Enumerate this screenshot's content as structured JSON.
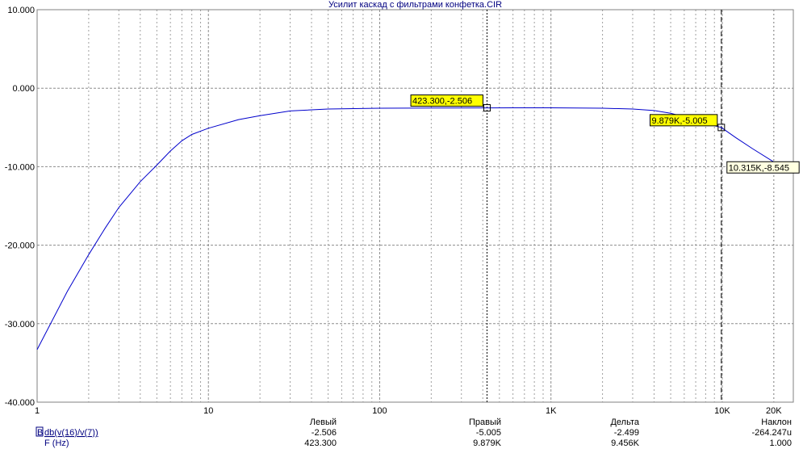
{
  "chart_data": {
    "type": "line",
    "title": "Усилит каскад с фильтрами конфетка.CIR",
    "x_scale": "log",
    "xlim": [
      1,
      26000
    ],
    "ylim": [
      -40,
      10
    ],
    "y_ticks": [
      "10.000",
      "0.000",
      "-10.000",
      "-20.000",
      "-30.000",
      "-40.000"
    ],
    "x_ticks": [
      {
        "value": 1,
        "label": "1"
      },
      {
        "value": 10,
        "label": "10"
      },
      {
        "value": 100,
        "label": "100"
      },
      {
        "value": 1000,
        "label": "1K"
      },
      {
        "value": 10000,
        "label": "10K"
      },
      {
        "value": 20000,
        "label": "20K"
      }
    ],
    "grid": true,
    "series": [
      {
        "name": "db(v(16)/v(7))",
        "color": "#0000cc",
        "x": [
          1,
          1.5,
          2,
          2.5,
          3,
          4,
          5,
          6,
          7,
          8,
          10,
          15,
          20,
          30,
          50,
          100,
          200,
          423.3,
          1000,
          2000,
          3000,
          4000,
          5000,
          6000,
          7000,
          8000,
          9879,
          10315,
          12000,
          15000,
          20000,
          26000
        ],
        "y": [
          -33.3,
          -25.9,
          -21.2,
          -17.8,
          -15.2,
          -11.9,
          -9.8,
          -8.0,
          -6.7,
          -5.9,
          -5.1,
          -4.0,
          -3.5,
          -2.9,
          -2.65,
          -2.55,
          -2.52,
          -2.506,
          -2.5,
          -2.55,
          -2.65,
          -2.85,
          -3.2,
          -3.65,
          -4.1,
          -4.5,
          -5.005,
          -5.3,
          -6.3,
          -7.7,
          -9.4,
          -10.6
        ]
      }
    ],
    "cursors": [
      {
        "x": 423.3,
        "y": -2.506,
        "label": "423.300,-2.506",
        "style": "dotted",
        "highlight": true
      },
      {
        "x": 9879,
        "y": -5.005,
        "label": "9.879K,-5.005",
        "style": "dashed",
        "highlight": true
      }
    ],
    "annotations": [
      {
        "x": 10315,
        "y": -8.545,
        "label": "10.315K,-8.545"
      }
    ],
    "readout": {
      "headers": [
        "Левый",
        "Правый",
        "Дельта",
        "Наклон"
      ],
      "rows": [
        {
          "label_prefix": "B",
          "label": "db(v(16)/v(7))",
          "values": [
            "-2.506",
            "-5.005",
            "-2.499",
            "-264.247u"
          ]
        },
        {
          "label_prefix": "",
          "label": "F (Hz)",
          "values": [
            "423.300",
            "9.879K",
            "9.456K",
            "1.000"
          ]
        }
      ]
    }
  }
}
